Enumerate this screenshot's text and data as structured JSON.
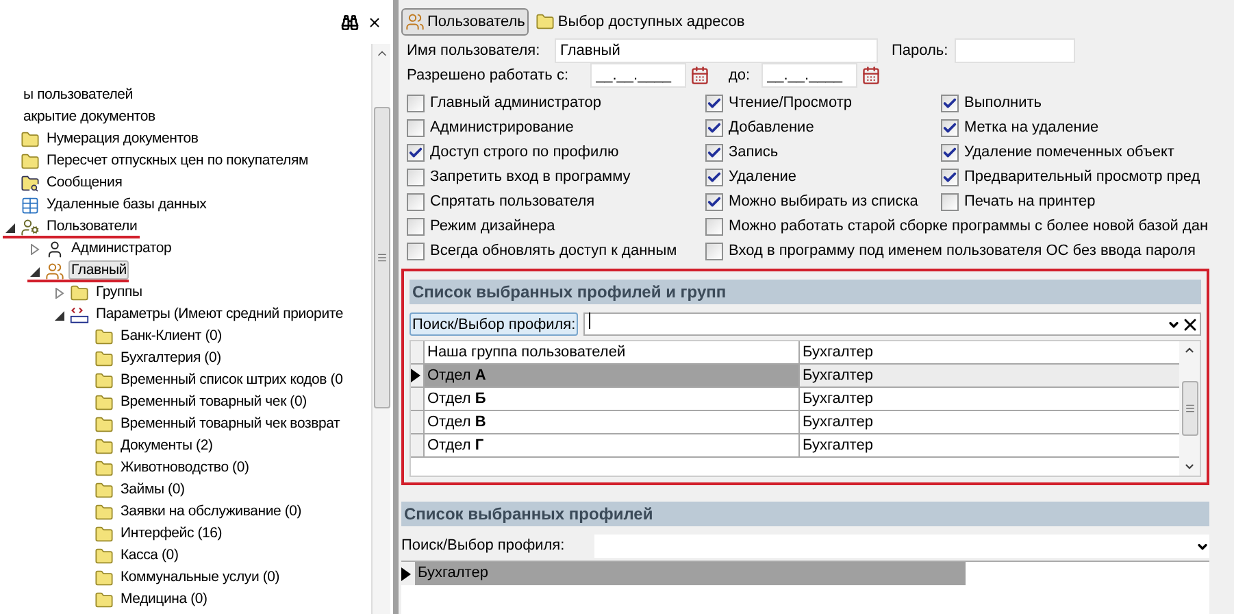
{
  "tree": {
    "items": [
      {
        "label": "ы пользователей",
        "kind": "none",
        "selected": false,
        "underlined": false
      },
      {
        "label": "акрытие документов",
        "kind": "none",
        "selected": false,
        "underlined": false
      },
      {
        "label": "Нумерация документов",
        "kind": "folder",
        "selected": false,
        "underlined": false
      },
      {
        "label": "Пересчет отпускных цен по покупателям",
        "kind": "folder",
        "selected": false,
        "underlined": false
      },
      {
        "label": "Сообщения",
        "kind": "search-folder",
        "selected": false,
        "underlined": false
      },
      {
        "label": "Удаленные базы данных",
        "kind": "table",
        "selected": false,
        "underlined": false
      },
      {
        "label": "Пользователи",
        "kind": "user-key",
        "selected": false,
        "underlined": true,
        "expanded": true,
        "children": [
          {
            "label": "Администратор",
            "kind": "user",
            "selected": false,
            "underlined": false,
            "expanded": false
          },
          {
            "label": "Главный",
            "kind": "users",
            "selected": true,
            "underlined": true,
            "expanded": true,
            "children": [
              {
                "label": "Группы",
                "kind": "folder",
                "selected": false,
                "underlined": false,
                "expanded": false
              },
              {
                "label": "Параметры (Имеют средний приорите",
                "kind": "params",
                "selected": false,
                "underlined": false,
                "expanded": true,
                "children": [
                  {
                    "label": "Банк-Клиент (0)",
                    "kind": "folder",
                    "selected": false,
                    "underlined": false
                  },
                  {
                    "label": "Бухгалтерия (0)",
                    "kind": "folder",
                    "selected": false,
                    "underlined": false
                  },
                  {
                    "label": "Временный список штрих кодов (0",
                    "kind": "folder",
                    "selected": false,
                    "underlined": false
                  },
                  {
                    "label": "Временный товарный чек (0)",
                    "kind": "folder",
                    "selected": false,
                    "underlined": false
                  },
                  {
                    "label": "Временный товарный чек возврат",
                    "kind": "folder",
                    "selected": false,
                    "underlined": false
                  },
                  {
                    "label": "Документы (2)",
                    "kind": "folder",
                    "selected": false,
                    "underlined": false
                  },
                  {
                    "label": "Животноводство (0)",
                    "kind": "folder",
                    "selected": false,
                    "underlined": false
                  },
                  {
                    "label": "Займы (0)",
                    "kind": "folder",
                    "selected": false,
                    "underlined": false
                  },
                  {
                    "label": "Заявки на обслуживание (0)",
                    "kind": "folder",
                    "selected": false,
                    "underlined": false
                  },
                  {
                    "label": "Интерфейс (16)",
                    "kind": "folder",
                    "selected": false,
                    "underlined": false
                  },
                  {
                    "label": "Касса (0)",
                    "kind": "folder",
                    "selected": false,
                    "underlined": false
                  },
                  {
                    "label": "Коммунальные услуи (0)",
                    "kind": "folder",
                    "selected": false,
                    "underlined": false
                  },
                  {
                    "label": "Медицина (0)",
                    "kind": "folder",
                    "selected": false,
                    "underlined": false
                  }
                ]
              }
            ]
          }
        ]
      }
    ]
  },
  "tabs": [
    {
      "label": "Пользователь",
      "kind": "users",
      "selected": true
    },
    {
      "label": "Выбор доступных адресов",
      "kind": "folder",
      "selected": false
    }
  ],
  "user_name": {
    "label": "Имя пользователя:",
    "value": "Главный"
  },
  "password": {
    "label": "Пароль:"
  },
  "allowed_from": {
    "label": "Разрешено работать с:",
    "value": "__.__.____"
  },
  "allowed_to": {
    "label": "до:",
    "value": "__.__.____"
  },
  "checkbox_rows": [
    [
      {
        "label": "Главный администратор",
        "checked": false
      },
      {
        "label": "Чтение/Просмотр",
        "checked": true
      },
      {
        "label": "Выполнить",
        "checked": true
      }
    ],
    [
      {
        "label": "Администрирование",
        "checked": false
      },
      {
        "label": "Добавление",
        "checked": true
      },
      {
        "label": "Метка на удаление",
        "checked": true
      }
    ],
    [
      {
        "label": "Доступ строго по профилю",
        "checked": true
      },
      {
        "label": "Запись",
        "checked": true
      },
      {
        "label": "Удаление помеченных объект",
        "checked": true
      }
    ],
    [
      {
        "label": "Запретить вход в программу",
        "checked": false
      },
      {
        "label": "Удаление",
        "checked": true
      },
      {
        "label": "Предварительный просмотр пред",
        "checked": true
      }
    ],
    [
      {
        "label": "Спрятать пользователя",
        "checked": false
      },
      {
        "label": "Можно выбирать из списка",
        "checked": true
      },
      {
        "label": "Печать на принтер",
        "checked": false
      }
    ],
    [
      {
        "label": "Режим дизайнера",
        "checked": false
      },
      {
        "label": "Можно работать старой сборке программы с более новой базой дан",
        "checked": false
      }
    ],
    [
      {
        "label": "Всегда обновлять доступ к данным",
        "checked": false
      },
      {
        "label": "Вход в программу под именем пользователя ОС без ввода пароля",
        "checked": false
      }
    ]
  ],
  "profiles_and_groups": {
    "title": "Список выбранных профилей и групп",
    "highlighted": true,
    "search_button": "Поиск/Выбор профиля:",
    "rows": [
      {
        "name": "Наша группа пользователей",
        "profile": "Бухгалтер",
        "selected": false
      },
      {
        "name": "Отдел **А**",
        "profile": "Бухгалтер",
        "selected": true
      },
      {
        "name": "Отдел **Б**",
        "profile": "Бухгалтер",
        "selected": false
      },
      {
        "name": "Отдел **В**",
        "profile": "Бухгалтер",
        "selected": false
      },
      {
        "name": "Отдел **Г**",
        "profile": "Бухгалтер",
        "selected": false
      }
    ]
  },
  "profiles": {
    "title": "Список выбранных профилей",
    "highlighted": false,
    "search_label": "Поиск/Выбор профиля:",
    "rows": [
      {
        "name": "Бухгалтер",
        "selected": true
      }
    ]
  }
}
